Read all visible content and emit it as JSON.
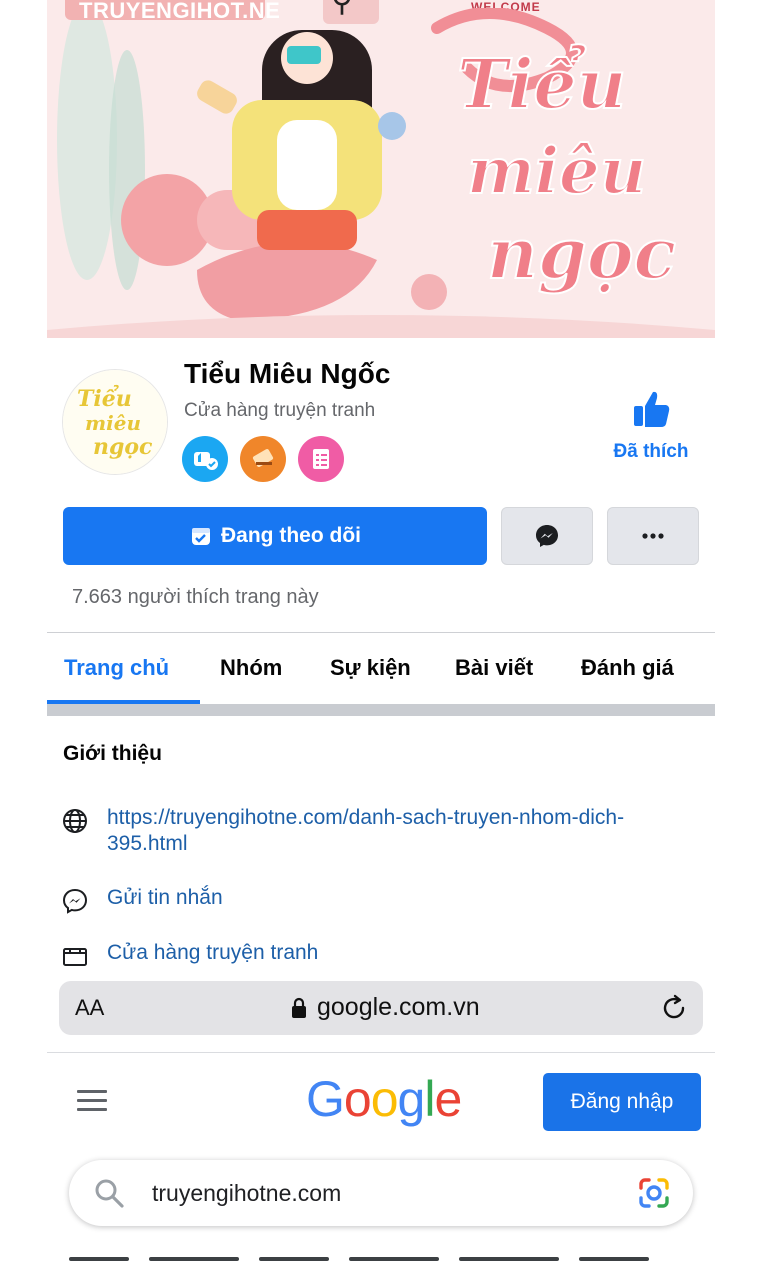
{
  "cover": {
    "brand_text": "TRUYENGIHOT.NE",
    "welcome_text": "WELCOME",
    "script_line1": "Tiểu",
    "script_line2": "miêu",
    "script_line3": "ngọc"
  },
  "profile": {
    "avatar_line1": "Tiểu",
    "avatar_line2": "miêu",
    "avatar_line3": "ngọc",
    "name": "Tiểu Miêu Ngốc",
    "category": "Cửa hàng truyện tranh",
    "liked_label": "Đã thích"
  },
  "actions": {
    "follow_label": "Đang theo dõi"
  },
  "likes_count_text": "7.663 người thích trang này",
  "tabs": [
    {
      "label": "Trang chủ",
      "active": true
    },
    {
      "label": "Nhóm",
      "active": false
    },
    {
      "label": "Sự kiện",
      "active": false
    },
    {
      "label": "Bài viết",
      "active": false
    },
    {
      "label": "Đánh giá",
      "active": false
    }
  ],
  "intro": {
    "title": "Giới thiệu",
    "website": "https://truyengihotne.com/danh-sach-truyen-nhom-dich-395.html",
    "message": "Gửi tin nhắn",
    "category": "Cửa hàng truyện tranh"
  },
  "browser": {
    "text_size_label": "AA",
    "url": "google.com.vn"
  },
  "google": {
    "logo_letters": [
      "G",
      "o",
      "o",
      "g",
      "l",
      "e"
    ],
    "signin_label": "Đăng nhập",
    "search_value": "truyengihotne.com"
  },
  "colors": {
    "facebook_blue": "#1877f2",
    "google_blue": "#4285f4",
    "google_red": "#ea4335",
    "google_yellow": "#fbbc05",
    "google_green": "#34a853",
    "cover_pink": "#f2b2b2"
  }
}
